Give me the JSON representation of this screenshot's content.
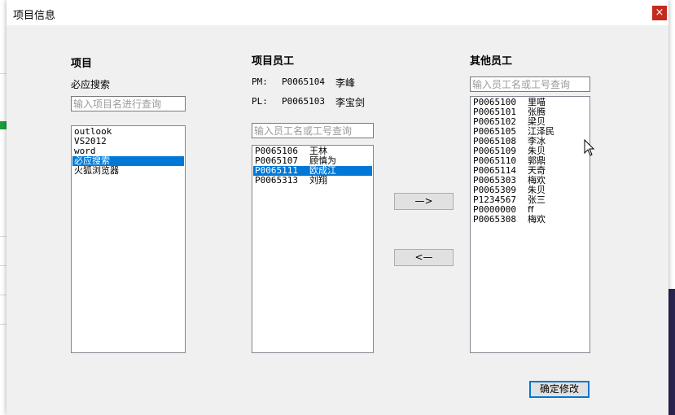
{
  "window": {
    "title": "项目信息",
    "close_label": "×"
  },
  "left_panel": {
    "heading": "项目",
    "current_project": "必应搜索",
    "search_placeholder": "输入项目名进行查询",
    "projects": [
      {
        "label": "outlook",
        "selected": false
      },
      {
        "label": "VS2012",
        "selected": false
      },
      {
        "label": "word",
        "selected": false
      },
      {
        "label": "必应搜索",
        "selected": true
      },
      {
        "label": "火狐浏览器",
        "selected": false
      }
    ]
  },
  "middle_panel": {
    "heading": "项目员工",
    "pm_label": "PM:",
    "pm_id": "P0065104",
    "pm_name": "李峰",
    "pl_label": "PL:",
    "pl_id": "P0065103",
    "pl_name": "李宝剑",
    "search_placeholder": "输入员工名或工号查询",
    "employees": [
      {
        "id": "P0065106",
        "name": "王林",
        "selected": false
      },
      {
        "id": "P0065107",
        "name": "顾慎为",
        "selected": false
      },
      {
        "id": "P0065111",
        "name": "欧成江",
        "selected": true
      },
      {
        "id": "P0065313",
        "name": "刘翔",
        "selected": false
      }
    ]
  },
  "transfer_buttons": {
    "add_label": "—>",
    "remove_label": "<—"
  },
  "right_panel": {
    "heading": "其他员工",
    "search_placeholder": "输入员工名或工号查询",
    "employees": [
      {
        "id": "P0065100",
        "name": "里喵"
      },
      {
        "id": "P0065101",
        "name": "张腾"
      },
      {
        "id": "P0065102",
        "name": "梁贝"
      },
      {
        "id": "P0065105",
        "name": "江泽民"
      },
      {
        "id": "P0065108",
        "name": "李冰"
      },
      {
        "id": "P0065109",
        "name": "朱贝"
      },
      {
        "id": "P0065110",
        "name": "郭鼎"
      },
      {
        "id": "P0065114",
        "name": "天奇"
      },
      {
        "id": "P0065303",
        "name": "梅欢"
      },
      {
        "id": "P0065309",
        "name": "朱贝"
      },
      {
        "id": "P1234567",
        "name": "张三"
      },
      {
        "id": "P0000000",
        "name": "ff"
      },
      {
        "id": "P0065308",
        "name": "梅欢"
      }
    ]
  },
  "footer": {
    "confirm_label": "确定修改"
  },
  "colors": {
    "selection": "#0078d7",
    "close_button": "#c42b1c"
  }
}
